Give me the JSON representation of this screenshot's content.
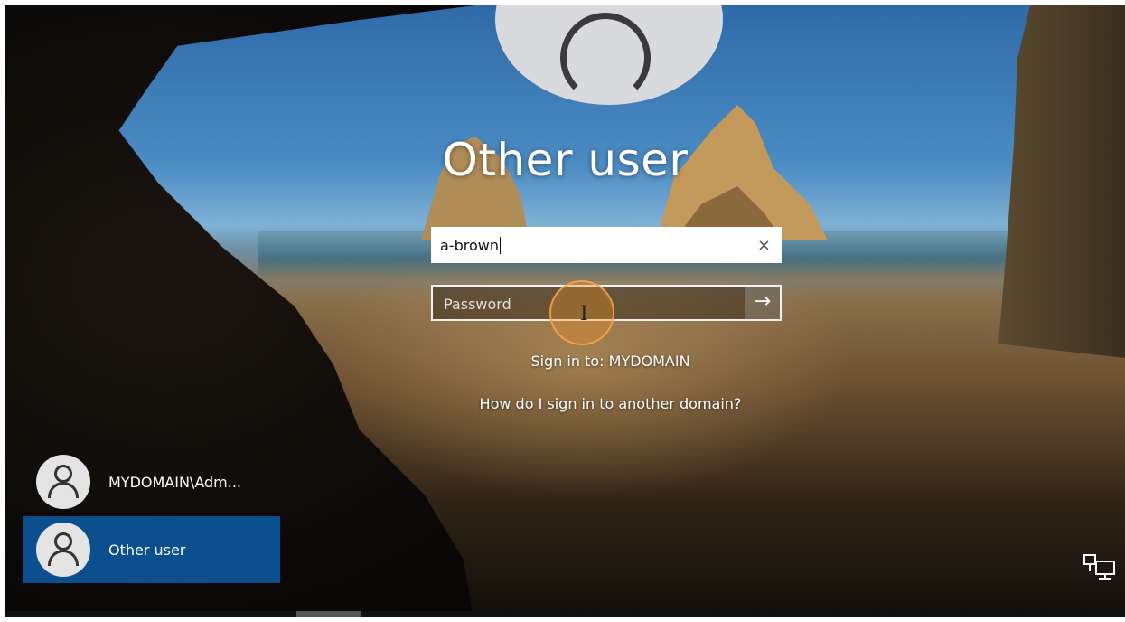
{
  "login": {
    "title": "Other user",
    "username_value": "a-brown",
    "clear_glyph": "×",
    "password_placeholder": "Password",
    "submit_glyph": "→",
    "sign_in_to": "Sign in to: MYDOMAIN",
    "other_domain_link": "How do I sign in to another domain?"
  },
  "user_list": [
    {
      "name": "MYDOMAIN\\Adm...",
      "selected": false
    },
    {
      "name": "Other user",
      "selected": true
    }
  ],
  "icons": {
    "network": "network-icon",
    "avatar": "user-avatar-icon",
    "clear": "clear-icon",
    "submit": "arrow-right-icon"
  },
  "colors": {
    "selected_user_bg": "#0b4f8f",
    "cursor_highlight": "#eb8c28"
  }
}
